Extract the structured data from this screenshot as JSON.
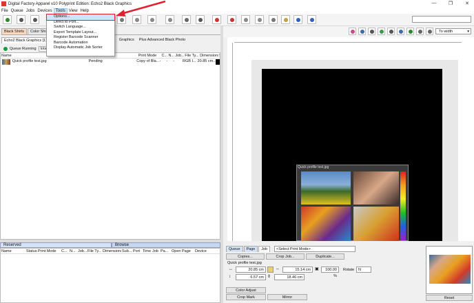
{
  "window": {
    "title": "Digital Factory Apparel v10 Polyprint Edition: Echo2 Black Graphics",
    "minimize": "—",
    "restore": "❐",
    "close": "✕"
  },
  "menu": [
    "File",
    "Queue",
    "Jobs",
    "Devices",
    "Tools",
    "View",
    "Help"
  ],
  "tools_menu": [
    "Options...",
    "Direct to Port...",
    "Switch Language...",
    "Export Template Layout...",
    "Register Barcode Scanner",
    "Barcode Automation",
    "Display Automatic Job Sorter"
  ],
  "shirt_tabs": [
    "Black Shirts",
    "Color Shirts"
  ],
  "queue_tabs": [
    "Echo2 Black Graphics [1]",
    "Graphics",
    "Plus Advanced Black Photo"
  ],
  "status": {
    "running": "Queue Running",
    "total": "total"
  },
  "job_columns": [
    "Name",
    "Print Mode",
    "C...",
    "N...",
    "Job...",
    "File Ty...",
    "Dimensions",
    "Su"
  ],
  "job_row": {
    "name": "Quick profile test.jpg",
    "status": "Pending",
    "mode": "Copy of Bla...",
    "c": "-",
    "n": "-",
    "j": "-",
    "type": "RGB I...",
    "dim": "20.85 cm..."
  },
  "bottom_tabs": [
    "Reserved",
    "Browse"
  ],
  "bottom_columns": [
    "Name",
    "Status",
    "Print Mode",
    "C...",
    "N...",
    "Job...",
    "File Ty...",
    "Dimensions",
    "Sub...",
    "Port",
    "Time",
    "Job",
    "Pa...",
    "Open Page",
    "Device"
  ],
  "zoom": "To width",
  "canvas_image_label": "Quick profile test.jpg",
  "props": {
    "tabs": [
      "Queue",
      "Page",
      "Job"
    ],
    "print_mode_placeholder": "<Select Print Mode>",
    "copies": "Copies...",
    "crop_job": "Crop Job...",
    "duplicate": "Duplicate...",
    "file": "Quick profile test.jpg",
    "x": "20.85 cm",
    "width": "15.14 cm",
    "scale": "100.00 %",
    "rotate_label": "Rotate",
    "rotate_value": "N",
    "y": "6.57 cm",
    "height": "18.46 cm",
    "color_adjust": "Color Adjust",
    "crop_mark": "Crop Mark",
    "mirror": "Mirror",
    "reset": "Reset"
  },
  "colors": {
    "accent_tab": "#fbd8c0",
    "arrow": "#e02030",
    "running": "#1a9a3a"
  }
}
